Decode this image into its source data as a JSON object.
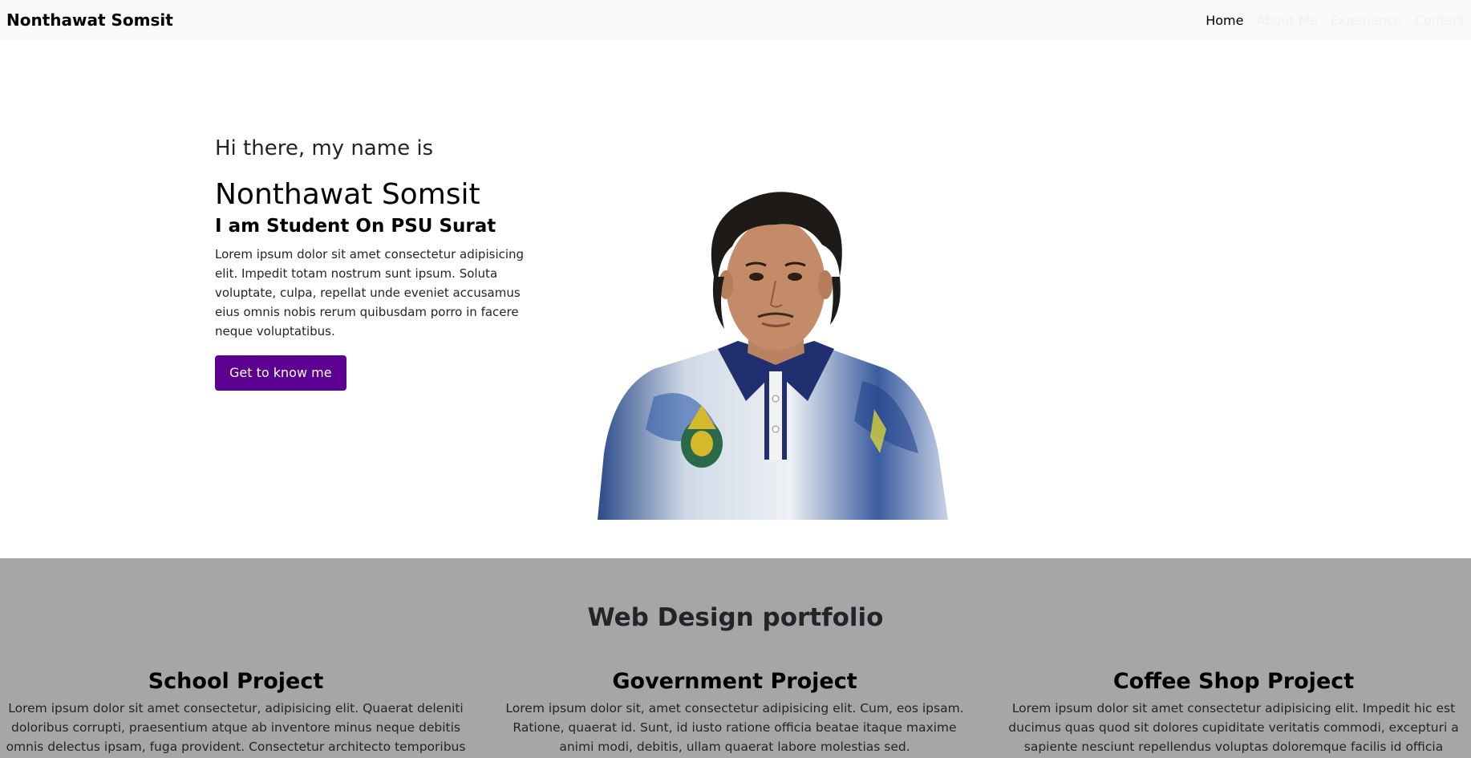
{
  "navbar": {
    "brand": "Nonthawat Somsit",
    "links": [
      {
        "label": "Home"
      },
      {
        "label": "About Me"
      },
      {
        "label": "Experience"
      },
      {
        "label": "Contact"
      }
    ]
  },
  "hero": {
    "greeting": "Hi there, my name is",
    "name": "Nonthawat Somsit",
    "subtitle": "I am Student On PSU Surat",
    "body": "Lorem ipsum dolor sit amet consectetur adipisicing elit. Impedit totam nostrum sunt ipsum. Soluta voluptate, culpa, repellat unde eveniet accusamus eius omnis nobis rerum quibusdam porro in facere neque voluptatibus.",
    "cta_label": "Get to know me"
  },
  "portfolio": {
    "title": "Web Design portfolio",
    "projects": [
      {
        "title": "School Project",
        "description": "Lorem ipsum dolor sit amet consectetur, adipisicing elit. Quaerat deleniti doloribus corrupti, praesentium atque ab inventore minus neque debitis omnis delectus ipsam, fuga provident. Consectetur architecto temporibus aspernatur debitis dolorem."
      },
      {
        "title": "Government Project",
        "description": "Lorem ipsum dolor sit, amet consectetur adipisicing elit. Cum, eos ipsam. Ratione, quaerat id. Sunt, id iusto ratione officia beatae itaque maxime animi modi, debitis, ullam quaerat labore molestias sed."
      },
      {
        "title": "Coffee Shop Project",
        "description": "Lorem ipsum dolor sit amet consectetur adipisicing elit. Impedit hic est ducimus quas quod sit dolores cupiditate veritatis commodi, excepturi a sapiente nesciunt repellendus voluptas doloremque facilis id officia possimus."
      }
    ]
  },
  "colors": {
    "navbar_bg": "#f8f9fa",
    "cta_bg": "#5c0091",
    "portfolio_bg": "#a6a6a6"
  }
}
